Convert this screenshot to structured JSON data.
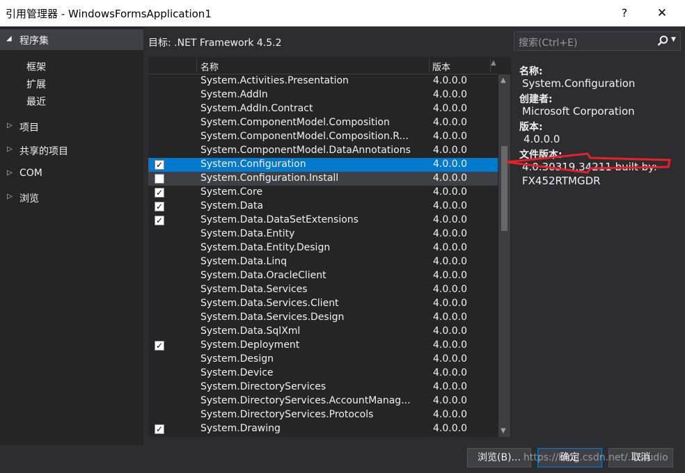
{
  "window": {
    "title": "引用管理器 - WindowsFormsApplication1",
    "help_glyph": "?",
    "close_glyph": "✕"
  },
  "sidebar": {
    "header": "程序集",
    "sub_items": [
      "框架",
      "扩展",
      "最近"
    ],
    "groups": [
      "项目",
      "共享的项目",
      "COM",
      "浏览"
    ]
  },
  "target_label": "目标: .NET Framework 4.5.2",
  "search": {
    "placeholder": "搜索(Ctrl+E)"
  },
  "columns": {
    "name": "名称",
    "version": "版本"
  },
  "assemblies": [
    {
      "name": "System.Activities.Presentation",
      "version": "4.0.0.0",
      "checked": false
    },
    {
      "name": "System.AddIn",
      "version": "4.0.0.0",
      "checked": false
    },
    {
      "name": "System.AddIn.Contract",
      "version": "4.0.0.0",
      "checked": false
    },
    {
      "name": "System.ComponentModel.Composition",
      "version": "4.0.0.0",
      "checked": false
    },
    {
      "name": "System.ComponentModel.Composition.R...",
      "version": "4.0.0.0",
      "checked": false
    },
    {
      "name": "System.ComponentModel.DataAnnotations",
      "version": "4.0.0.0",
      "checked": false
    },
    {
      "name": "System.Configuration",
      "version": "4.0.0.0",
      "checked": true,
      "selected": true
    },
    {
      "name": "System.Configuration.Install",
      "version": "4.0.0.0",
      "checked": false,
      "hover": true
    },
    {
      "name": "System.Core",
      "version": "4.0.0.0",
      "checked": true
    },
    {
      "name": "System.Data",
      "version": "4.0.0.0",
      "checked": true
    },
    {
      "name": "System.Data.DataSetExtensions",
      "version": "4.0.0.0",
      "checked": true
    },
    {
      "name": "System.Data.Entity",
      "version": "4.0.0.0",
      "checked": false
    },
    {
      "name": "System.Data.Entity.Design",
      "version": "4.0.0.0",
      "checked": false
    },
    {
      "name": "System.Data.Linq",
      "version": "4.0.0.0",
      "checked": false
    },
    {
      "name": "System.Data.OracleClient",
      "version": "4.0.0.0",
      "checked": false
    },
    {
      "name": "System.Data.Services",
      "version": "4.0.0.0",
      "checked": false
    },
    {
      "name": "System.Data.Services.Client",
      "version": "4.0.0.0",
      "checked": false
    },
    {
      "name": "System.Data.Services.Design",
      "version": "4.0.0.0",
      "checked": false
    },
    {
      "name": "System.Data.SqlXml",
      "version": "4.0.0.0",
      "checked": false
    },
    {
      "name": "System.Deployment",
      "version": "4.0.0.0",
      "checked": true
    },
    {
      "name": "System.Design",
      "version": "4.0.0.0",
      "checked": false
    },
    {
      "name": "System.Device",
      "version": "4.0.0.0",
      "checked": false
    },
    {
      "name": "System.DirectoryServices",
      "version": "4.0.0.0",
      "checked": false
    },
    {
      "name": "System.DirectoryServices.AccountManag...",
      "version": "4.0.0.0",
      "checked": false
    },
    {
      "name": "System.DirectoryServices.Protocols",
      "version": "4.0.0.0",
      "checked": false
    },
    {
      "name": "System.Drawing",
      "version": "4.0.0.0",
      "checked": true
    }
  ],
  "details": {
    "name_label": "名称:",
    "name_value": "System.Configuration",
    "creator_label": "创建者:",
    "creator_value": "Microsoft Corporation",
    "version_label": "版本:",
    "version_value": "4.0.0.0",
    "file_version_label": "文件版本:",
    "file_version_value": "4.0.30319.34211 built by:",
    "file_version_value2": "FX452RTMGDR"
  },
  "buttons": {
    "browse": "浏览(B)...",
    "ok": "确定",
    "cancel": "取消"
  },
  "watermark": "https://blog.csdn.net/...Studio",
  "colors": {
    "selection": "#007acc",
    "annotation": "#e8202a"
  }
}
